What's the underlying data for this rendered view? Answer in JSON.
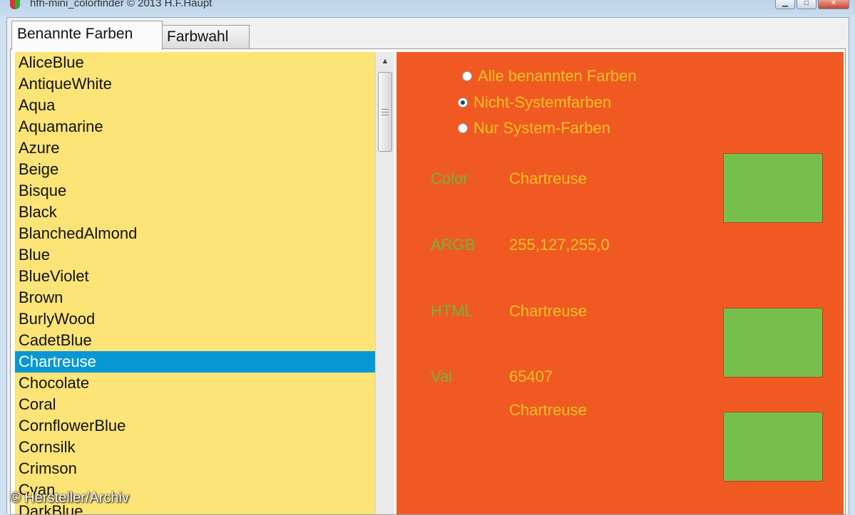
{
  "window": {
    "title": "hfh-mini_colorfinder © 2013  H.F.Haupt",
    "controls": {
      "minimize": "▁",
      "maximize": "□",
      "close": "✕"
    }
  },
  "tabs": [
    {
      "label": "Benannte Farben",
      "active": true
    },
    {
      "label": "Farbwahl",
      "active": false
    }
  ],
  "color_list": {
    "items": [
      "AliceBlue",
      "AntiqueWhite",
      "Aqua",
      "Aquamarine",
      "Azure",
      "Beige",
      "Bisque",
      "Black",
      "BlanchedAlmond",
      "Blue",
      "BlueViolet",
      "Brown",
      "BurlyWood",
      "CadetBlue",
      "Chartreuse",
      "Chocolate",
      "Coral",
      "CornflowerBlue",
      "Cornsilk",
      "Crimson",
      "Cyan",
      "DarkBlue"
    ],
    "selected": "Chartreuse"
  },
  "filter": {
    "options": [
      "Alle benannten Farben",
      "Nicht-Systemfarben",
      "Nur System-Farben"
    ],
    "selected_index": 1
  },
  "details": {
    "color_label": "Color",
    "color_value": "Chartreuse",
    "argb_label": "ARGB",
    "argb_value": "255,127,255,0",
    "html_label": "HTML",
    "html_value": "Chartreuse",
    "val_label": "Val",
    "val_value": "65407",
    "extra_value": "Chartreuse"
  },
  "colors": {
    "list_background": "#fde477",
    "selection": "#0798d3",
    "panel_background": "#f05a22",
    "label_text": "#72b33f",
    "value_text": "#f3c027",
    "swatch": "#76bf4c"
  },
  "watermark": "© Hersteller/Archiv"
}
